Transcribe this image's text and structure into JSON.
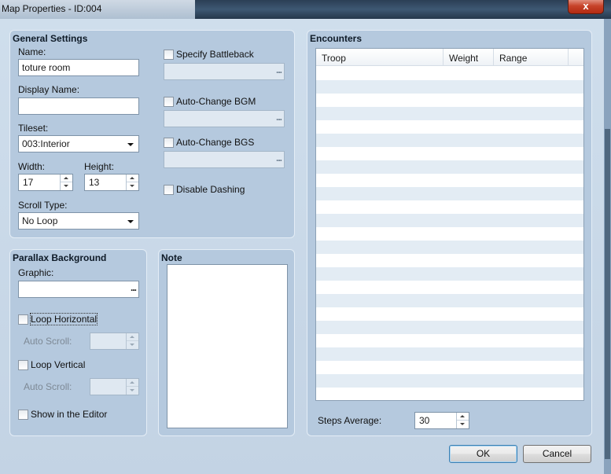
{
  "window": {
    "title": "Map Properties - ID:004",
    "close_glyph": "x"
  },
  "general": {
    "title": "General Settings",
    "name_label": "Name:",
    "name_value": "toture room",
    "display_name_label": "Display Name:",
    "display_name_value": "",
    "tileset_label": "Tileset:",
    "tileset_value": "003:Interior",
    "width_label": "Width:",
    "width_value": "17",
    "height_label": "Height:",
    "height_value": "13",
    "scroll_type_label": "Scroll Type:",
    "scroll_type_value": "No Loop",
    "specify_battleback": {
      "label": "Specify Battleback",
      "checked": false
    },
    "auto_bgm": {
      "label": "Auto-Change BGM",
      "checked": false
    },
    "auto_bgs": {
      "label": "Auto-Change BGS",
      "checked": false
    },
    "disable_dashing": {
      "label": "Disable Dashing",
      "checked": false
    },
    "ellipsis": "..."
  },
  "parallax": {
    "title": "Parallax Background",
    "graphic_label": "Graphic:",
    "graphic_value": "",
    "loop_horizontal": {
      "label": "Loop Horizontal",
      "checked": false
    },
    "auto_scroll_label_1": "Auto Scroll:",
    "loop_vertical": {
      "label": "Loop Vertical",
      "checked": false
    },
    "auto_scroll_label_2": "Auto Scroll:",
    "show_in_editor": {
      "label": "Show in the Editor",
      "checked": false
    }
  },
  "note": {
    "title": "Note",
    "value": ""
  },
  "encounters": {
    "title": "Encounters",
    "columns": [
      "Troop",
      "Weight",
      "Range"
    ],
    "rows": [],
    "steps_label": "Steps Average:",
    "steps_value": "30"
  },
  "footer": {
    "ok_label": "OK",
    "cancel_label": "Cancel"
  },
  "colors": {
    "group_bg": "#b5c9de",
    "client_bg": "#c9d7e6",
    "titlebar": "#2b3f55",
    "close": "#c7432a"
  }
}
